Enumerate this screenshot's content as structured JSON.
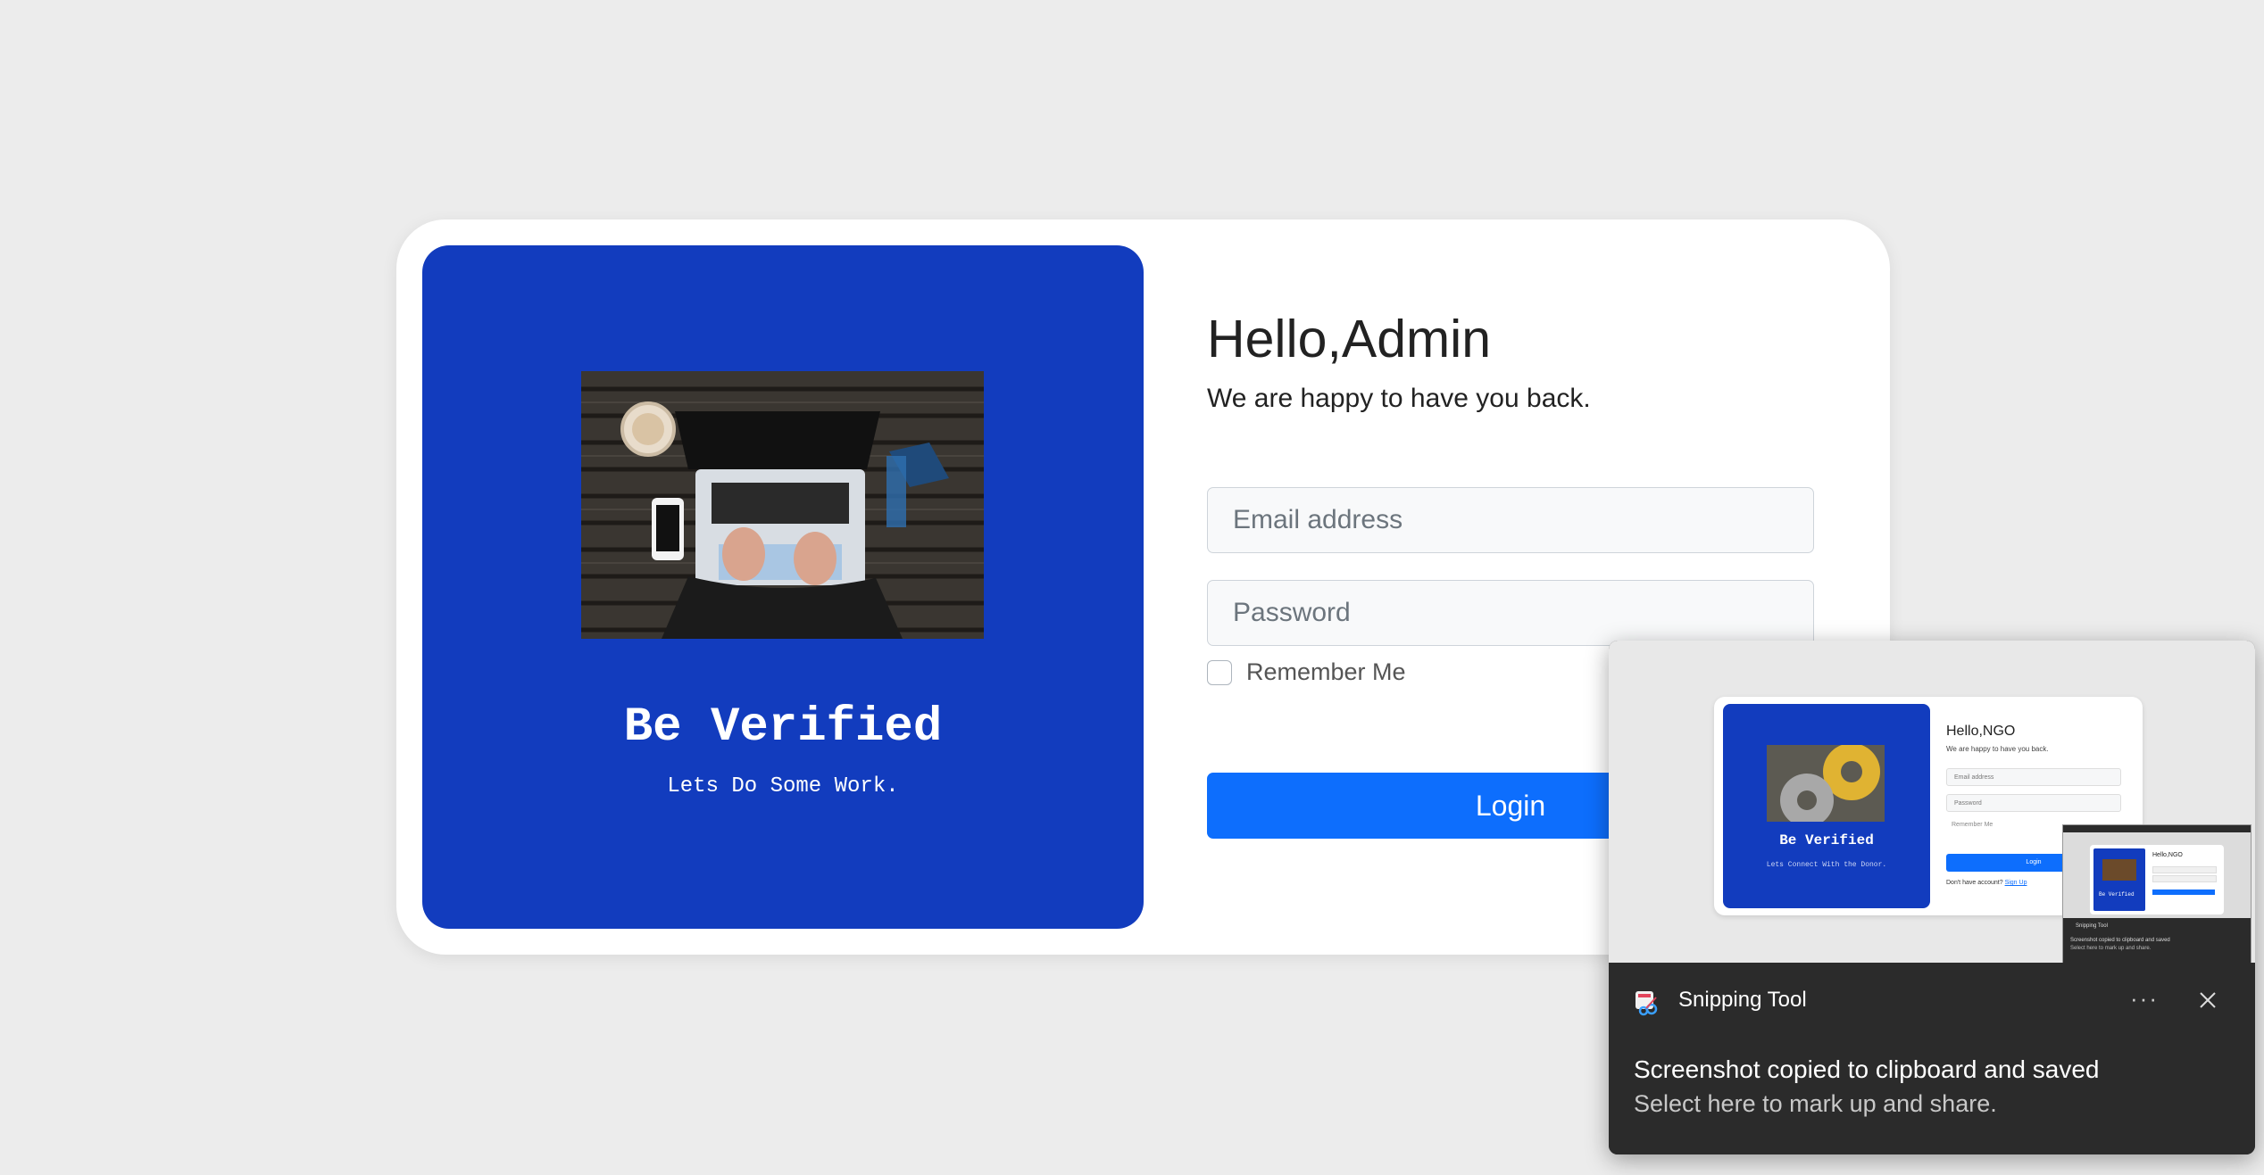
{
  "login": {
    "brand_title": "Be Verified",
    "brand_tagline": "Lets Do Some Work.",
    "greeting": "Hello,Admin",
    "subtitle": "We are happy to have you back.",
    "email_placeholder": "Email address",
    "password_placeholder": "Password",
    "remember_label": "Remember Me",
    "login_button": "Login"
  },
  "toast": {
    "app_name": "Snipping Tool",
    "more_label": "···",
    "message": "Screenshot copied to clipboard and saved",
    "hint": "Select here to mark up and share.",
    "preview": {
      "greeting": "Hello,NGO",
      "subtitle": "We are happy to have you back.",
      "brand_title": "Be Verified",
      "brand_tagline": "Lets Connect With the Donor.",
      "email_placeholder": "Email address",
      "password_placeholder": "Password",
      "remember_label": "Remember Me",
      "login_button": "Login",
      "signup_text": "Don't have account?",
      "signup_link": "Sign Up",
      "nested": {
        "greeting": "Hello,NGO",
        "brand_title": "Be Verified",
        "toast_app": "Snipping Tool",
        "toast_message": "Screenshot copied to clipboard and saved",
        "toast_hint": "Select here to mark up and share."
      }
    }
  }
}
